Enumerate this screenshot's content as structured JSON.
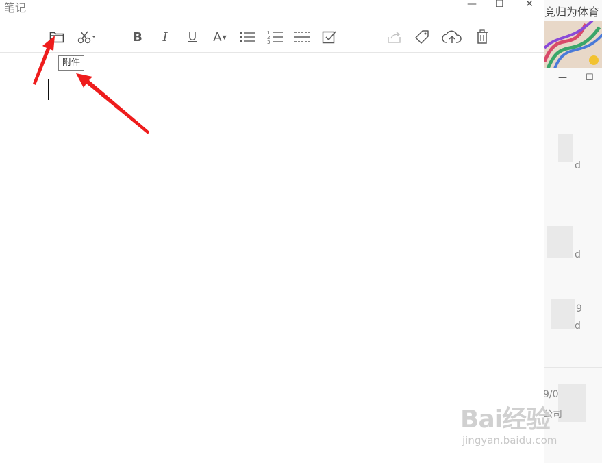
{
  "window": {
    "title": "笔记",
    "minimize_icon": "minimize-icon",
    "maximize_icon": "maximize-icon",
    "close_icon": "close-icon"
  },
  "toolbar": {
    "items": [
      {
        "name": "attachment-folder-icon"
      },
      {
        "name": "screenshot-scissors-icon"
      },
      {
        "name": "bold-icon",
        "label": "B"
      },
      {
        "name": "italic-icon",
        "label": "I"
      },
      {
        "name": "underline-icon",
        "label": "U"
      },
      {
        "name": "font-color-icon",
        "label": "A"
      },
      {
        "name": "bullet-list-icon"
      },
      {
        "name": "numbered-list-icon"
      },
      {
        "name": "divider-line-icon"
      },
      {
        "name": "checkbox-icon"
      },
      {
        "name": "share-icon"
      },
      {
        "name": "tag-icon"
      },
      {
        "name": "cloud-upload-icon"
      },
      {
        "name": "trash-icon"
      }
    ]
  },
  "tooltip": {
    "text": "附件"
  },
  "right_panel": {
    "title": "竞归为体育",
    "lines": [
      "d",
      "d",
      "9",
      "d",
      "9/0",
      "公司"
    ]
  },
  "watermark": {
    "main": "Bai经验",
    "sub": "jingyan.baidu.com"
  },
  "colors": {
    "arrow": "#ee1c1c",
    "icon": "#5b5b5b",
    "border": "#e6e6e6"
  }
}
